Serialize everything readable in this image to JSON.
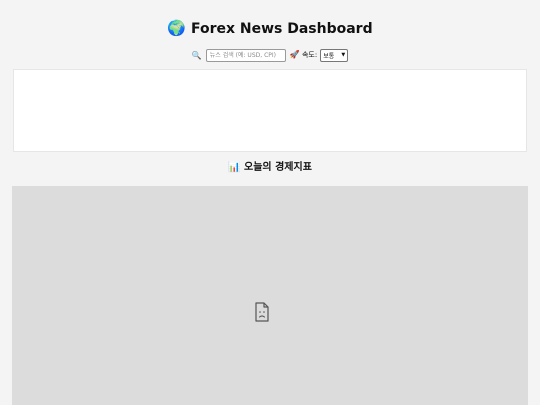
{
  "header": {
    "title_icon": "🌍",
    "title": "Forex News Dashboard"
  },
  "controls": {
    "search_icon": "🔍",
    "search_placeholder": "뉴스 검색 (예: USD, CPI)",
    "search_value": "",
    "speed_icon": "🚀",
    "speed_label": "속도:",
    "speed_selected": "보통"
  },
  "news": {
    "items": []
  },
  "indicators": {
    "title_icon": "📊",
    "title": "오늘의 경제지표"
  },
  "icons": {
    "broken_content": "sad-page-icon"
  },
  "colors": {
    "background": "#f4f4f4",
    "panel": "#ffffff",
    "embed_placeholder": "#dcdcdc"
  }
}
